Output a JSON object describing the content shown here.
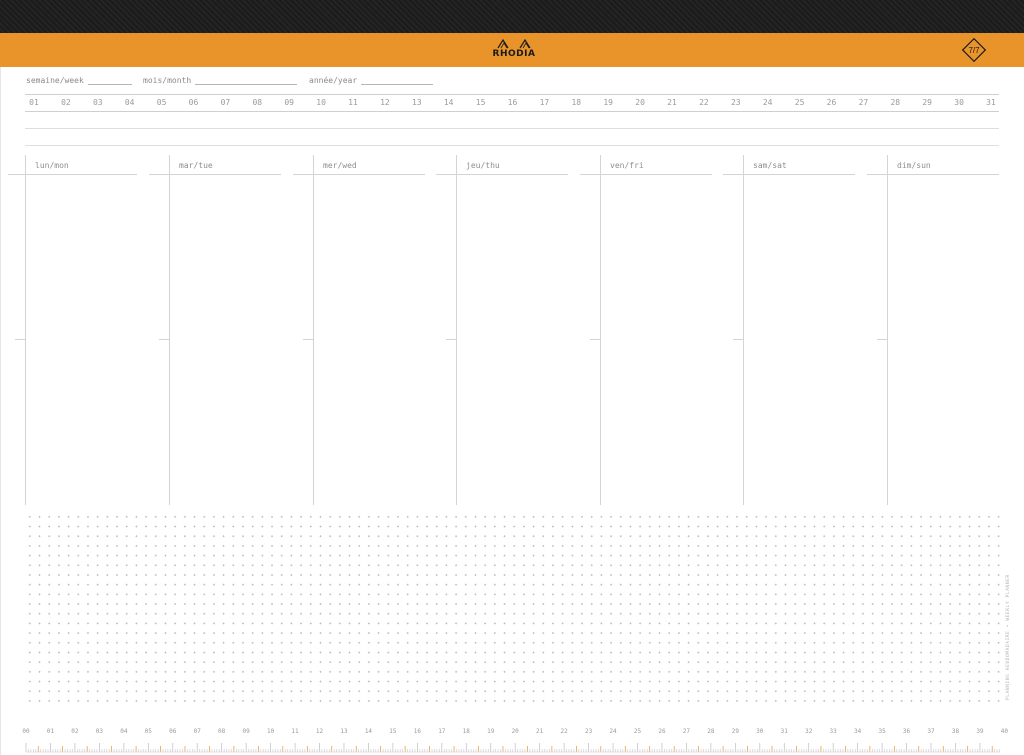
{
  "brand": {
    "name": "RHODIA",
    "badge_text": "7/7",
    "accent": "#e8942a",
    "header_dark": "#1b1b1b"
  },
  "fields": {
    "week": "semaine/week",
    "month": "mois/month",
    "year": "année/year"
  },
  "month_days": [
    "01",
    "02",
    "03",
    "04",
    "05",
    "06",
    "07",
    "08",
    "09",
    "10",
    "11",
    "12",
    "13",
    "14",
    "15",
    "16",
    "17",
    "18",
    "19",
    "20",
    "21",
    "22",
    "23",
    "24",
    "25",
    "26",
    "27",
    "28",
    "29",
    "30",
    "31"
  ],
  "week_days": [
    "lun/mon",
    "mar/tue",
    "mer/wed",
    "jeu/thu",
    "ven/fri",
    "sam/sat",
    "dim/sun"
  ],
  "side_text": "PLANNING HEBDOMADAIRE • WEEKLY PLANNER",
  "ruler_numbers": [
    "00",
    "01",
    "02",
    "03",
    "04",
    "05",
    "06",
    "07",
    "08",
    "09",
    "10",
    "11",
    "12",
    "13",
    "14",
    "15",
    "16",
    "17",
    "18",
    "19",
    "20",
    "21",
    "22",
    "23",
    "24",
    "25",
    "26",
    "27",
    "28",
    "29",
    "30",
    "31",
    "32",
    "33",
    "34",
    "35",
    "36",
    "37",
    "38",
    "39",
    "40"
  ]
}
